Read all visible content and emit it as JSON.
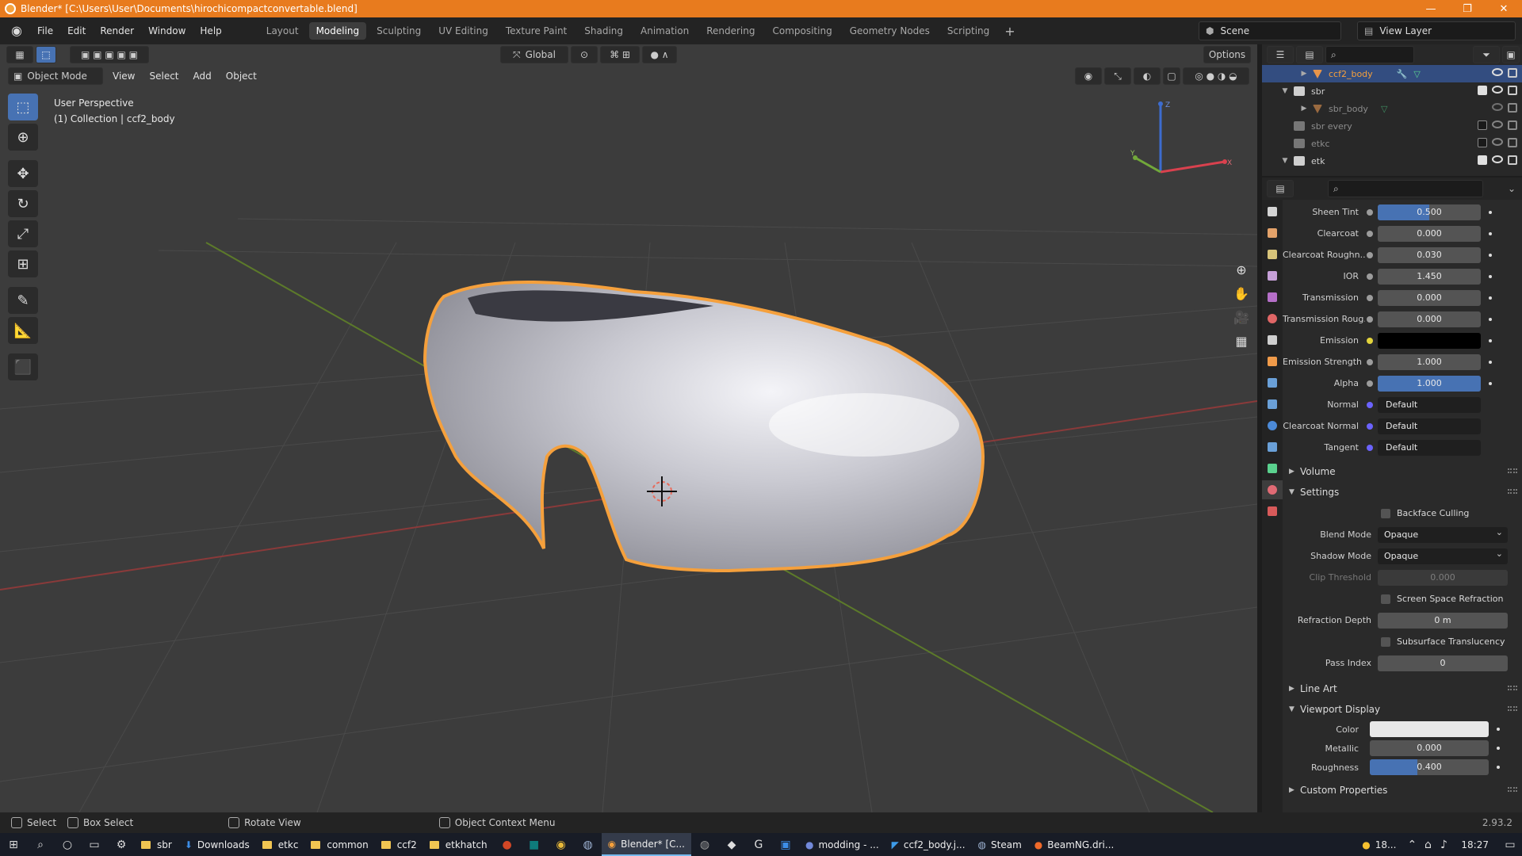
{
  "window": {
    "title": "Blender* [C:\\Users\\User\\Documents\\hirochicompactconvertable.blend]",
    "controls": [
      "—",
      "❐",
      "✕"
    ]
  },
  "menubar": {
    "menus": [
      "File",
      "Edit",
      "Render",
      "Window",
      "Help"
    ],
    "workspaces": [
      "Layout",
      "Modeling",
      "Sculpting",
      "UV Editing",
      "Texture Paint",
      "Shading",
      "Animation",
      "Rendering",
      "Compositing",
      "Geometry Nodes",
      "Scripting"
    ],
    "active_workspace": "Modeling",
    "add_label": "+",
    "scene": "Scene",
    "view_layer": "View Layer"
  },
  "viewport": {
    "mode": "Object Mode",
    "menus": [
      "View",
      "Select",
      "Add",
      "Object"
    ],
    "transform_orientation": "Global",
    "options_label": "Options",
    "info_line1": "User Perspective",
    "info_line2": "(1) Collection | ccf2_body",
    "gizmo_axes": [
      "X",
      "Y",
      "Z"
    ],
    "accent_color": "#f5a03c"
  },
  "outliner": {
    "rows": [
      {
        "name": "ccf2_body",
        "type": "object",
        "selected": true,
        "expanded": false
      },
      {
        "name": "sbr",
        "type": "collection",
        "checked": true,
        "expanded": true
      },
      {
        "name": "sbr_body",
        "type": "object",
        "dim": true
      },
      {
        "name": "sbr every",
        "type": "collection",
        "checked": false,
        "dim": true
      },
      {
        "name": "etkc",
        "type": "collection",
        "checked": false,
        "dim": true
      },
      {
        "name": "etk",
        "type": "collection",
        "checked": true,
        "expanded": true
      }
    ]
  },
  "properties": {
    "fields": [
      {
        "label": "Sheen Tint",
        "value": "0.500",
        "fill": 0.5
      },
      {
        "label": "Clearcoat",
        "value": "0.000"
      },
      {
        "label": "Clearcoat Roughn...",
        "value": "0.030"
      },
      {
        "label": "IOR",
        "value": "1.450"
      },
      {
        "label": "Transmission",
        "value": "0.000"
      },
      {
        "label": "Transmission Roug...",
        "value": "0.000"
      },
      {
        "label": "Emission",
        "value": "",
        "swatch": "#000000"
      },
      {
        "label": "Emission Strength",
        "value": "1.000"
      },
      {
        "label": "Alpha",
        "value": "1.000",
        "fill": 1.0
      },
      {
        "label": "Normal",
        "value": "Default",
        "link": true
      },
      {
        "label": "Clearcoat Normal",
        "value": "Default",
        "link": true
      },
      {
        "label": "Tangent",
        "value": "Default",
        "link": true
      }
    ],
    "sections": {
      "volume": "Volume",
      "settings": "Settings",
      "line_art": "Line Art",
      "viewport_display": "Viewport Display",
      "custom_properties": "Custom Properties"
    },
    "settings": {
      "backface_culling": "Backface Culling",
      "blend_mode_label": "Blend Mode",
      "blend_mode": "Opaque",
      "shadow_mode_label": "Shadow Mode",
      "shadow_mode": "Opaque",
      "clip_threshold_label": "Clip Threshold",
      "clip_threshold": "0.000",
      "screen_space_refraction": "Screen Space Refraction",
      "refraction_depth_label": "Refraction Depth",
      "refraction_depth": "0 m",
      "subsurface_translucency": "Subsurface Translucency",
      "pass_index_label": "Pass Index",
      "pass_index": "0"
    },
    "viewport_display": {
      "color_label": "Color",
      "color": "#e8e8e8",
      "metallic_label": "Metallic",
      "metallic": "0.000",
      "roughness_label": "Roughness",
      "roughness": "0.400",
      "roughness_fill": 0.4
    }
  },
  "statusbar": {
    "select": "Select",
    "box_select": "Box Select",
    "rotate_view": "Rotate View",
    "context_menu": "Object Context Menu",
    "version": "2.93.2"
  },
  "taskbar": {
    "apps": [
      {
        "label": "sbr",
        "type": "folder"
      },
      {
        "label": "Downloads",
        "type": "download"
      },
      {
        "label": "etkc",
        "type": "folder"
      },
      {
        "label": "common",
        "type": "folder"
      },
      {
        "label": "ccf2",
        "type": "folder"
      },
      {
        "label": "etkhatch",
        "type": "folder"
      },
      {
        "label": "Blender* [C...",
        "type": "blender",
        "active": true
      },
      {
        "label": "modding - ...",
        "type": "discord"
      },
      {
        "label": "ccf2_body.j...",
        "type": "vscode"
      },
      {
        "label": "Steam",
        "type": "steam"
      },
      {
        "label": "BeamNG.dri...",
        "type": "beamng"
      }
    ],
    "weather": "18...",
    "time": "18:27"
  }
}
